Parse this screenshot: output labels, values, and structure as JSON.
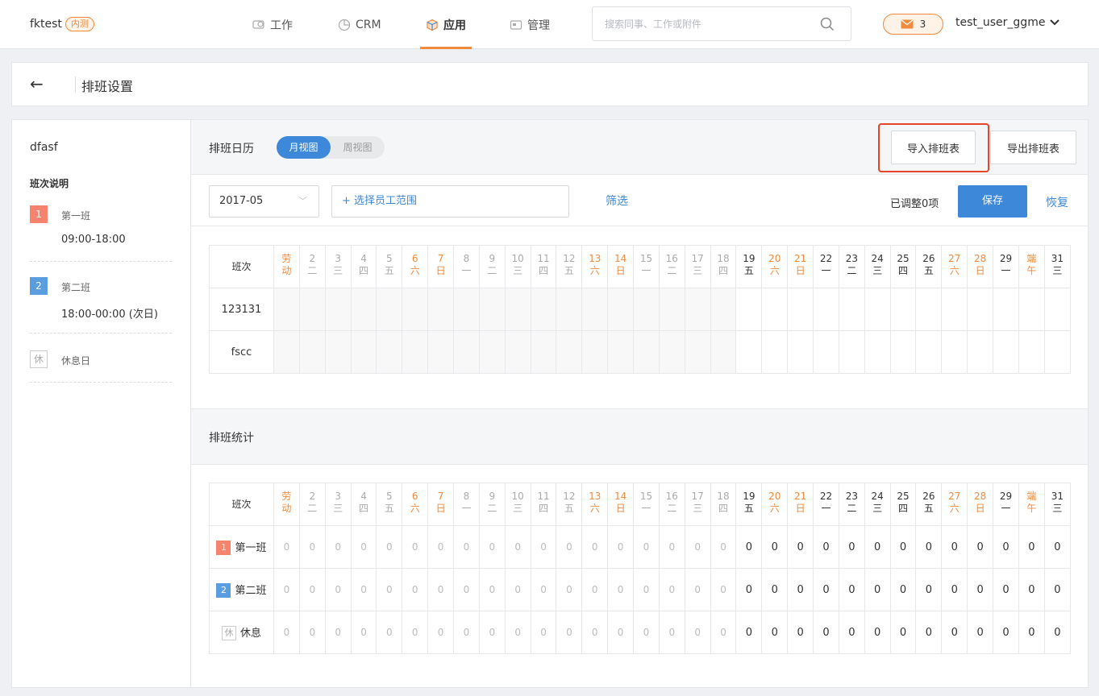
{
  "topnav": {
    "brand": "fktest",
    "brand_badge": "内测",
    "tabs": [
      {
        "label": "工作",
        "icon": "chat-icon"
      },
      {
        "label": "CRM",
        "icon": "pie-icon"
      },
      {
        "label": "应用",
        "icon": "cube-icon",
        "active": true
      },
      {
        "label": "管理",
        "icon": "card-icon"
      }
    ],
    "search_placeholder": "搜索同事、工作或附件",
    "message_count": "3",
    "user_name": "test_user_ggme"
  },
  "titlebar": {
    "title": "排班设置"
  },
  "sidebar": {
    "title": "dfasf",
    "subtitle": "班次说明",
    "shifts": [
      {
        "tag": "1",
        "name": "第一班",
        "time": "09:00-18:00",
        "color": "#f5836d"
      },
      {
        "tag": "2",
        "name": "第二班",
        "time": "18:00-00:00 (次日)",
        "color": "#5a9ee0"
      },
      {
        "tag": "休",
        "name": "休息日",
        "time": "",
        "color": "#ffffff"
      }
    ]
  },
  "calendar": {
    "title": "排班日历",
    "views": [
      "月视图",
      "周视图"
    ],
    "import_button": "导入排班表",
    "export_button": "导出排班表",
    "month": "2017-05",
    "employee_range": "+ 选择员工范围",
    "filter": "筛选",
    "adjusted": "已调整0项",
    "save": "保存",
    "restore": "恢复",
    "header_label": "班次",
    "days": [
      {
        "d": "劳",
        "w": "动"
      },
      {
        "d": "2",
        "w": "二"
      },
      {
        "d": "3",
        "w": "三"
      },
      {
        "d": "4",
        "w": "四"
      },
      {
        "d": "5",
        "w": "五"
      },
      {
        "d": "6",
        "w": "六"
      },
      {
        "d": "7",
        "w": "日"
      },
      {
        "d": "8",
        "w": "一"
      },
      {
        "d": "9",
        "w": "二"
      },
      {
        "d": "10",
        "w": "三"
      },
      {
        "d": "11",
        "w": "四"
      },
      {
        "d": "12",
        "w": "五"
      },
      {
        "d": "13",
        "w": "六"
      },
      {
        "d": "14",
        "w": "日"
      },
      {
        "d": "15",
        "w": "一"
      },
      {
        "d": "16",
        "w": "二"
      },
      {
        "d": "17",
        "w": "三"
      },
      {
        "d": "18",
        "w": "四"
      },
      {
        "d": "19",
        "w": "五"
      },
      {
        "d": "20",
        "w": "六"
      },
      {
        "d": "21",
        "w": "日"
      },
      {
        "d": "22",
        "w": "一"
      },
      {
        "d": "23",
        "w": "二"
      },
      {
        "d": "24",
        "w": "三"
      },
      {
        "d": "25",
        "w": "四"
      },
      {
        "d": "26",
        "w": "五"
      },
      {
        "d": "27",
        "w": "六"
      },
      {
        "d": "28",
        "w": "日"
      },
      {
        "d": "29",
        "w": "一"
      },
      {
        "d": "端",
        "w": "午"
      },
      {
        "d": "31",
        "w": "三"
      }
    ],
    "rows": [
      "123131",
      "fscc"
    ]
  },
  "stats": {
    "title": "排班统计",
    "header_label": "班次",
    "rows": [
      {
        "tag": "1",
        "name": "第一班",
        "values": [
          0,
          0,
          0,
          0,
          0,
          0,
          0,
          0,
          0,
          0,
          0,
          0,
          0,
          0,
          0,
          0,
          0,
          0,
          0,
          0,
          0,
          0,
          0,
          0,
          0,
          0,
          0,
          0,
          0,
          0,
          0
        ]
      },
      {
        "tag": "2",
        "name": "第二班",
        "values": [
          0,
          0,
          0,
          0,
          0,
          0,
          0,
          0,
          0,
          0,
          0,
          0,
          0,
          0,
          0,
          0,
          0,
          0,
          0,
          0,
          0,
          0,
          0,
          0,
          0,
          0,
          0,
          0,
          0,
          0,
          0
        ]
      },
      {
        "tag": "休",
        "name": "休息",
        "values": [
          0,
          0,
          0,
          0,
          0,
          0,
          0,
          0,
          0,
          0,
          0,
          0,
          0,
          0,
          0,
          0,
          0,
          0,
          0,
          0,
          0,
          0,
          0,
          0,
          0,
          0,
          0,
          0,
          0,
          0,
          0
        ]
      }
    ]
  }
}
